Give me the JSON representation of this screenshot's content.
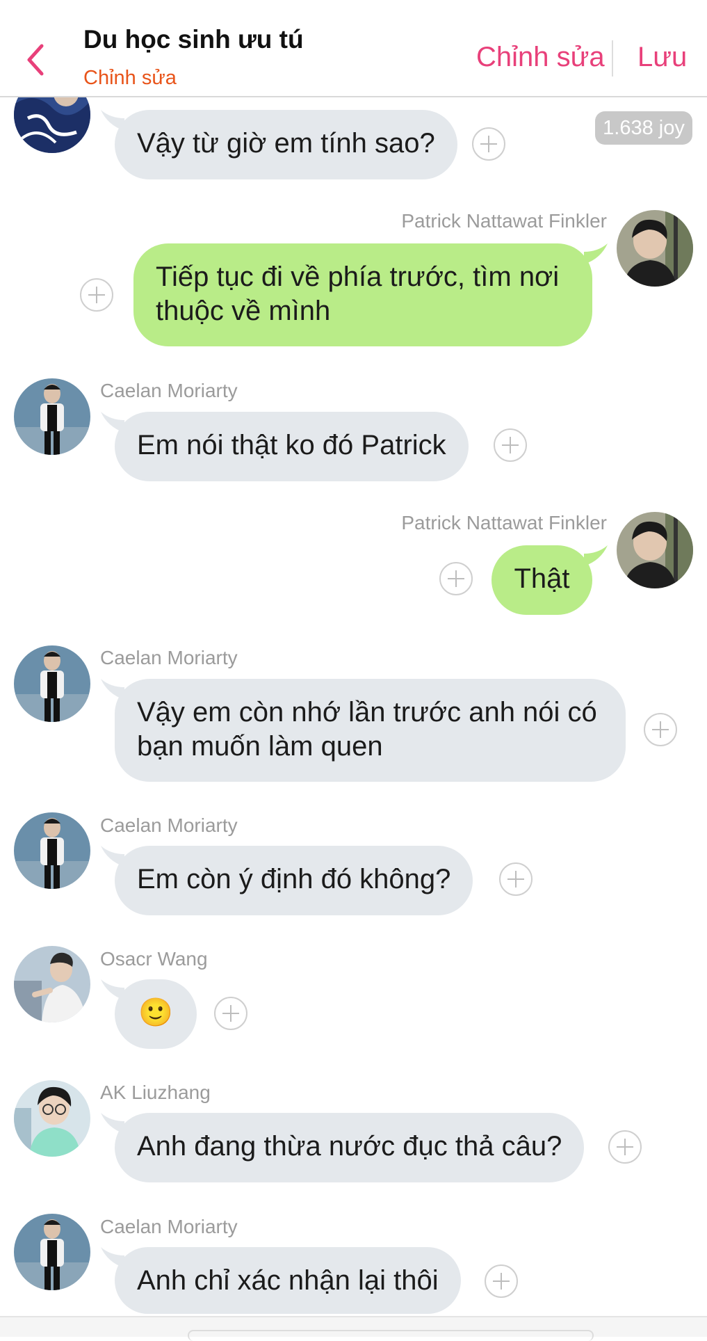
{
  "header": {
    "title": "Du học sinh ưu tú",
    "subtitle": "Chỉnh sửa",
    "edit_label": "Chỉnh sửa",
    "save_label": "Lưu"
  },
  "joy_badge": "1.638 joy",
  "messages": [
    {
      "sender": "",
      "text": "Vậy từ giờ em tính sao?",
      "direction": "in"
    },
    {
      "sender": "Patrick Nattawat Finkler",
      "text": "Tiếp tục đi về phía trước, tìm nơi thuộc về mình",
      "direction": "out"
    },
    {
      "sender": "Caelan Moriarty",
      "text": "Em nói thật ko đó Patrick",
      "direction": "in"
    },
    {
      "sender": "Patrick Nattawat Finkler",
      "text": "Thật",
      "direction": "out"
    },
    {
      "sender": "Caelan Moriarty",
      "text": "Vậy em còn nhớ lần trước anh nói có bạn muốn làm quen",
      "direction": "in"
    },
    {
      "sender": "Caelan Moriarty",
      "text": "Em còn ý định đó không?",
      "direction": "in"
    },
    {
      "sender": "Osacr Wang",
      "text": "🙂",
      "direction": "in"
    },
    {
      "sender": "AK Liuzhang",
      "text": "Anh đang thừa nước đục thả câu?",
      "direction": "in"
    },
    {
      "sender": "Caelan Moriarty",
      "text": "Anh chỉ xác nhận lại thôi",
      "direction": "in"
    }
  ],
  "colors": {
    "accent_pink": "#e8407a",
    "subtitle_orange": "#e8541a",
    "incoming_bubble": "#e4e8ec",
    "outgoing_bubble": "#b9ec88"
  },
  "icons": {
    "back": "chevron-left-icon",
    "add_reaction": "plus-circle-icon"
  }
}
